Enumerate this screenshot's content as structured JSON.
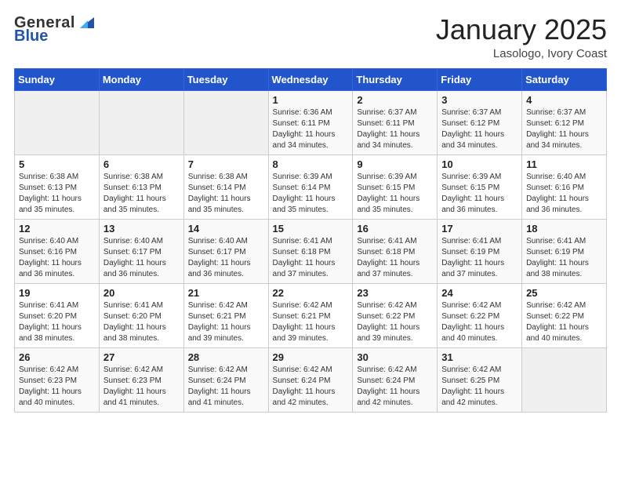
{
  "header": {
    "logo_general": "General",
    "logo_blue": "Blue",
    "month_title": "January 2025",
    "location": "Lasologo, Ivory Coast"
  },
  "weekdays": [
    "Sunday",
    "Monday",
    "Tuesday",
    "Wednesday",
    "Thursday",
    "Friday",
    "Saturday"
  ],
  "weeks": [
    [
      {
        "day": "",
        "info": ""
      },
      {
        "day": "",
        "info": ""
      },
      {
        "day": "",
        "info": ""
      },
      {
        "day": "1",
        "info": "Sunrise: 6:36 AM\nSunset: 6:11 PM\nDaylight: 11 hours\nand 34 minutes."
      },
      {
        "day": "2",
        "info": "Sunrise: 6:37 AM\nSunset: 6:11 PM\nDaylight: 11 hours\nand 34 minutes."
      },
      {
        "day": "3",
        "info": "Sunrise: 6:37 AM\nSunset: 6:12 PM\nDaylight: 11 hours\nand 34 minutes."
      },
      {
        "day": "4",
        "info": "Sunrise: 6:37 AM\nSunset: 6:12 PM\nDaylight: 11 hours\nand 34 minutes."
      }
    ],
    [
      {
        "day": "5",
        "info": "Sunrise: 6:38 AM\nSunset: 6:13 PM\nDaylight: 11 hours\nand 35 minutes."
      },
      {
        "day": "6",
        "info": "Sunrise: 6:38 AM\nSunset: 6:13 PM\nDaylight: 11 hours\nand 35 minutes."
      },
      {
        "day": "7",
        "info": "Sunrise: 6:38 AM\nSunset: 6:14 PM\nDaylight: 11 hours\nand 35 minutes."
      },
      {
        "day": "8",
        "info": "Sunrise: 6:39 AM\nSunset: 6:14 PM\nDaylight: 11 hours\nand 35 minutes."
      },
      {
        "day": "9",
        "info": "Sunrise: 6:39 AM\nSunset: 6:15 PM\nDaylight: 11 hours\nand 35 minutes."
      },
      {
        "day": "10",
        "info": "Sunrise: 6:39 AM\nSunset: 6:15 PM\nDaylight: 11 hours\nand 36 minutes."
      },
      {
        "day": "11",
        "info": "Sunrise: 6:40 AM\nSunset: 6:16 PM\nDaylight: 11 hours\nand 36 minutes."
      }
    ],
    [
      {
        "day": "12",
        "info": "Sunrise: 6:40 AM\nSunset: 6:16 PM\nDaylight: 11 hours\nand 36 minutes."
      },
      {
        "day": "13",
        "info": "Sunrise: 6:40 AM\nSunset: 6:17 PM\nDaylight: 11 hours\nand 36 minutes."
      },
      {
        "day": "14",
        "info": "Sunrise: 6:40 AM\nSunset: 6:17 PM\nDaylight: 11 hours\nand 36 minutes."
      },
      {
        "day": "15",
        "info": "Sunrise: 6:41 AM\nSunset: 6:18 PM\nDaylight: 11 hours\nand 37 minutes."
      },
      {
        "day": "16",
        "info": "Sunrise: 6:41 AM\nSunset: 6:18 PM\nDaylight: 11 hours\nand 37 minutes."
      },
      {
        "day": "17",
        "info": "Sunrise: 6:41 AM\nSunset: 6:19 PM\nDaylight: 11 hours\nand 37 minutes."
      },
      {
        "day": "18",
        "info": "Sunrise: 6:41 AM\nSunset: 6:19 PM\nDaylight: 11 hours\nand 38 minutes."
      }
    ],
    [
      {
        "day": "19",
        "info": "Sunrise: 6:41 AM\nSunset: 6:20 PM\nDaylight: 11 hours\nand 38 minutes."
      },
      {
        "day": "20",
        "info": "Sunrise: 6:41 AM\nSunset: 6:20 PM\nDaylight: 11 hours\nand 38 minutes."
      },
      {
        "day": "21",
        "info": "Sunrise: 6:42 AM\nSunset: 6:21 PM\nDaylight: 11 hours\nand 39 minutes."
      },
      {
        "day": "22",
        "info": "Sunrise: 6:42 AM\nSunset: 6:21 PM\nDaylight: 11 hours\nand 39 minutes."
      },
      {
        "day": "23",
        "info": "Sunrise: 6:42 AM\nSunset: 6:22 PM\nDaylight: 11 hours\nand 39 minutes."
      },
      {
        "day": "24",
        "info": "Sunrise: 6:42 AM\nSunset: 6:22 PM\nDaylight: 11 hours\nand 40 minutes."
      },
      {
        "day": "25",
        "info": "Sunrise: 6:42 AM\nSunset: 6:22 PM\nDaylight: 11 hours\nand 40 minutes."
      }
    ],
    [
      {
        "day": "26",
        "info": "Sunrise: 6:42 AM\nSunset: 6:23 PM\nDaylight: 11 hours\nand 40 minutes."
      },
      {
        "day": "27",
        "info": "Sunrise: 6:42 AM\nSunset: 6:23 PM\nDaylight: 11 hours\nand 41 minutes."
      },
      {
        "day": "28",
        "info": "Sunrise: 6:42 AM\nSunset: 6:24 PM\nDaylight: 11 hours\nand 41 minutes."
      },
      {
        "day": "29",
        "info": "Sunrise: 6:42 AM\nSunset: 6:24 PM\nDaylight: 11 hours\nand 42 minutes."
      },
      {
        "day": "30",
        "info": "Sunrise: 6:42 AM\nSunset: 6:24 PM\nDaylight: 11 hours\nand 42 minutes."
      },
      {
        "day": "31",
        "info": "Sunrise: 6:42 AM\nSunset: 6:25 PM\nDaylight: 11 hours\nand 42 minutes."
      },
      {
        "day": "",
        "info": ""
      }
    ]
  ]
}
